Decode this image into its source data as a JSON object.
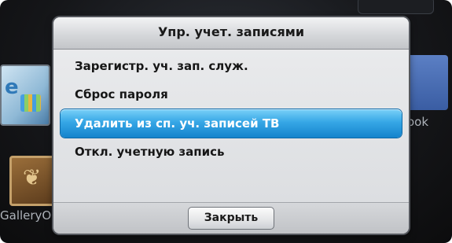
{
  "dialog": {
    "title": "Упр. учет. записями",
    "items": [
      {
        "label": "Зарегистр. уч. зап. служ."
      },
      {
        "label": "Сброс пароля"
      },
      {
        "label": "Удалить из сп. уч. записей ТВ",
        "selected": true
      },
      {
        "label": "Откл. учетную запись"
      }
    ],
    "close_label": "Закрыть"
  },
  "background": {
    "left_app_label": "GalleryO",
    "right_app_label": "ook"
  },
  "colors": {
    "selection": "#36a7e6",
    "dialog_background": "#dcdee1"
  }
}
